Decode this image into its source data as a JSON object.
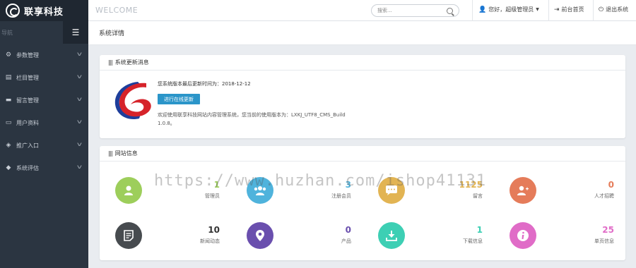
{
  "brand": {
    "name": "联享科技"
  },
  "sidebar": {
    "header_label": "导航",
    "toggle_icon": "menu-icon",
    "items": [
      {
        "label": "参数管理",
        "icon": "gear-icon"
      },
      {
        "label": "栏目管理",
        "icon": "list-icon"
      },
      {
        "label": "留言管理",
        "icon": "message-icon"
      },
      {
        "label": "用户资料",
        "icon": "card-icon"
      },
      {
        "label": "推广入口",
        "icon": "share-icon"
      },
      {
        "label": "系统评估",
        "icon": "shield-icon"
      }
    ]
  },
  "topbar": {
    "welcome": "WELCOME",
    "search_placeholder": "搜索...",
    "user_label": "您好，超级管理员",
    "frontend_label": "前台首页",
    "logout_label": "退出系统"
  },
  "page": {
    "title": "系统详情"
  },
  "update_panel": {
    "title": "系统更新消息",
    "last_update_text": "您系统版本最后更新时间为：2018-12-12",
    "button_label": "进行在线更新",
    "version_text": "欢迎使用联享科技网站内容管理系统，您当前的使用版本为：LXKJ_UTF8_CMS_Build 1.0.8。"
  },
  "stats_panel": {
    "title": "网站信息",
    "items": [
      {
        "label": "管理员",
        "value": "1",
        "color": "#9dce5b",
        "val_color": "#9dce5b",
        "icon": "user-icon"
      },
      {
        "label": "注册会员",
        "value": "3",
        "color": "#4fb3dc",
        "val_color": "#4fb3dc",
        "icon": "group-icon"
      },
      {
        "label": "留言",
        "value": "1125",
        "color": "#e2b453",
        "val_color": "#e2b453",
        "icon": "chat-icon"
      },
      {
        "label": "人才招聘",
        "value": "0",
        "color": "#e57c5a",
        "val_color": "#e57c5a",
        "icon": "add-user-icon"
      },
      {
        "label": "新闻动态",
        "value": "10",
        "color": "#474b4f",
        "val_color": "#333333",
        "icon": "document-icon"
      },
      {
        "label": "产品",
        "value": "0",
        "color": "#6a4fae",
        "val_color": "#6a4fae",
        "icon": "location-icon"
      },
      {
        "label": "下载信息",
        "value": "1",
        "color": "#3dcfb4",
        "val_color": "#3dcfb4",
        "icon": "download-icon"
      },
      {
        "label": "单页信息",
        "value": "25",
        "color": "#e06cc7",
        "val_color": "#e06cc7",
        "icon": "info-icon"
      }
    ]
  },
  "watermark": "https://www.huzhan.com/ishop41131"
}
